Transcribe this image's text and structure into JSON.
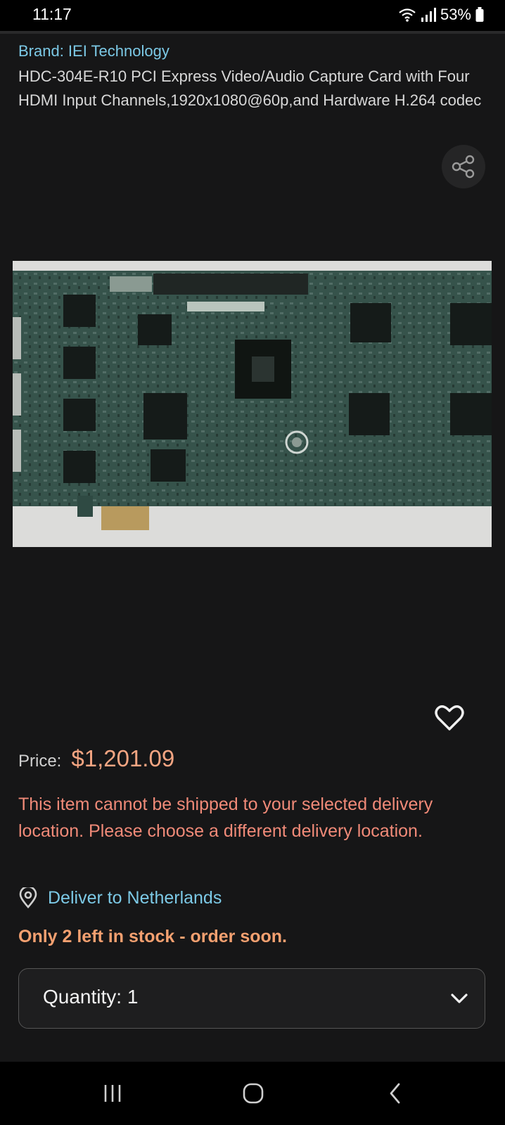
{
  "status_bar": {
    "time": "11:17",
    "battery": "53%"
  },
  "product": {
    "brand": "Brand: IEI Technology",
    "title": "HDC-304E-R10 PCI Express Video/Audio Capture Card with Four HDMI Input Channels,1920x1080@60p,and Hardware H.264 codec",
    "image_icon": "product-photo"
  },
  "price": {
    "label": "Price:",
    "value": "$1,201.09"
  },
  "shipping_warning": "This item cannot be shipped to your selected delivery location. Please choose a different delivery location.",
  "delivery": {
    "label": "Deliver to Netherlands",
    "icon": "location-pin-icon"
  },
  "stock_message": "Only 2 left in stock - order soon.",
  "quantity": {
    "label": "Quantity:",
    "value": "1"
  },
  "colors": {
    "background": "#161617",
    "link": "#7cc9e6",
    "price": "#f4a582",
    "warning": "#f08a78",
    "stock": "#f4a070"
  }
}
